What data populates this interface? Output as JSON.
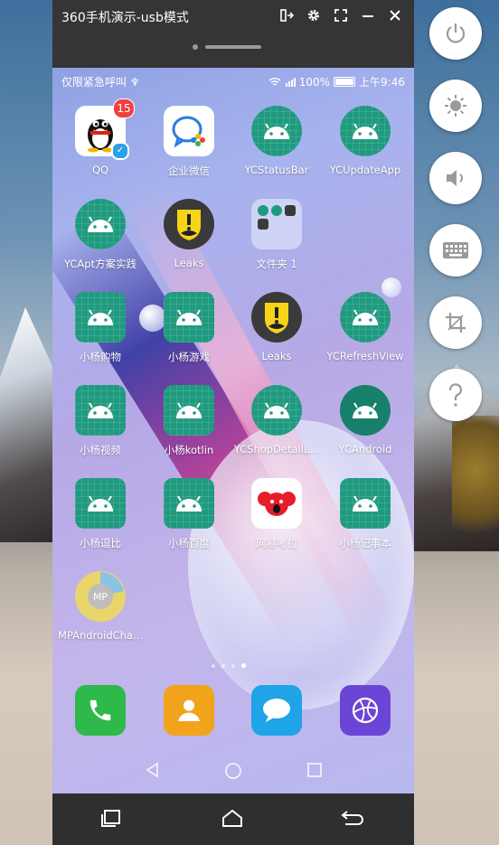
{
  "window": {
    "title": "360手机演示-usb模式"
  },
  "statusbar": {
    "left_text": "仅限紧急呼叫",
    "usb_symbol": "♆",
    "battery": "100%",
    "time": "上午9:46"
  },
  "apps": [
    {
      "label": "QQ",
      "badge": "15"
    },
    {
      "label": "企业微信"
    },
    {
      "label": "YCStatusBar"
    },
    {
      "label": "YCUpdateApp"
    },
    {
      "label": "YCApt方案实践"
    },
    {
      "label": "Leaks"
    },
    {
      "label": "文件夹 1"
    },
    {
      "label": "小杨购物"
    },
    {
      "label": "小杨游戏"
    },
    {
      "label": "Leaks"
    },
    {
      "label": "YCRefreshView"
    },
    {
      "label": "小杨视频"
    },
    {
      "label": "小杨kotlin"
    },
    {
      "label": "YCShopDetailL..."
    },
    {
      "label": "YCAndroid"
    },
    {
      "label": "小杨逗比"
    },
    {
      "label": "小杨百度"
    },
    {
      "label": "网易考拉"
    },
    {
      "label": "小杨记事本"
    },
    {
      "label": "MPAndroidCha...",
      "icon_text": "MP"
    }
  ],
  "dock": {
    "phone": "phone-icon",
    "contacts": "contacts-icon",
    "messages": "messages-icon",
    "browser": "browser-icon"
  },
  "page_indicator": {
    "pages": 4,
    "current": 4
  },
  "colors": {
    "android_green": "#1f9a7f",
    "badge_red": "#f04040",
    "titlebar": "#353535"
  }
}
